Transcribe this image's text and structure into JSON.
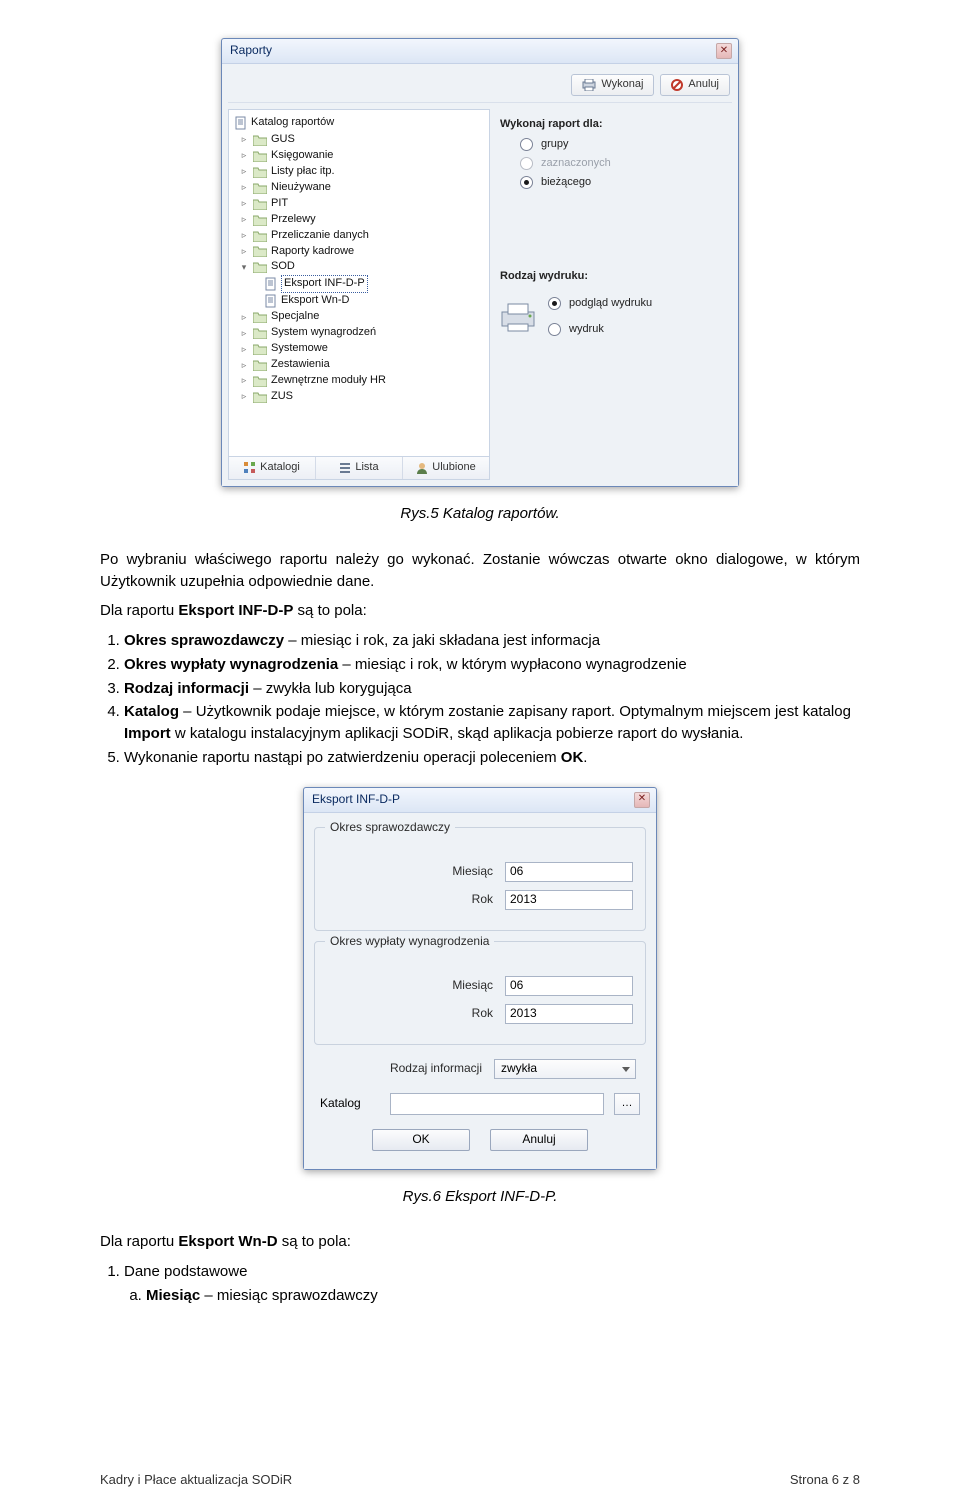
{
  "raporty_win": {
    "title": "Raporty",
    "buttons": {
      "wykonaj": "Wykonaj",
      "anuluj": "Anuluj"
    },
    "tree": {
      "root": "Katalog raportów",
      "items": [
        "GUS",
        "Księgowanie",
        "Listy płac itp.",
        "Nieużywane",
        "PIT",
        "Przelewy",
        "Przeliczanie danych",
        "Raporty kadrowe"
      ],
      "sod": {
        "label": "SOD",
        "children": [
          "Eksport INF-D-P",
          "Eksport Wn-D"
        ]
      },
      "items2": [
        "Specjalne",
        "System wynagrodzeń",
        "Systemowe",
        "Zestawienia",
        "Zewnętrzne moduły HR",
        "ZUS"
      ]
    },
    "tabs": {
      "katalogi": "Katalogi",
      "lista": "Lista",
      "ulubione": "Ulubione"
    },
    "right": {
      "h1": "Wykonaj raport dla:",
      "r1": "grupy",
      "r2": "zaznaczonych",
      "r3": "bieżącego",
      "h2": "Rodzaj wydruku:",
      "p1": "podgląd wydruku",
      "p2": "wydruk"
    }
  },
  "caption1": "Rys.5 Katalog raportów.",
  "para1": "Po wybraniu właściwego raportu należy go wykonać. Zostanie wówczas otwarte okno dialogowe, w którym Użytkownik uzupełnia odpowiednie dane.",
  "para2a": "Dla raportu ",
  "para2b": "Eksport INF-D-P",
  "para2c": " są to pola:",
  "list1": [
    {
      "b": "Okres sprawozdawczy",
      "t": " – miesiąc i rok, za jaki składana jest informacja"
    },
    {
      "b": "Okres wypłaty wynagrodzenia",
      "t": " – miesiąc i rok, w którym wypłacono wynagrodzenie"
    },
    {
      "b": "Rodzaj informacji",
      "t": " – zwykła lub korygująca"
    },
    {
      "b": "Katalog",
      "t": " – Użytkownik podaje miejsce, w którym zostanie zapisany raport. Optymalnym miejscem jest katalog Import w katalogu instalacyjnym aplikacji SODiR, skąd aplikacja pobierze raport do wysłania."
    },
    {
      "b": "",
      "t": "Wykonanie raportu nastąpi po zatwierdzeniu operacji poleceniem OK."
    }
  ],
  "eksport_win": {
    "title": "Eksport INF-D-P",
    "group1": {
      "title": "Okres sprawozdawczy",
      "miesiac_lab": "Miesiąc",
      "miesiac": "06",
      "rok_lab": "Rok",
      "rok": "2013"
    },
    "group2": {
      "title": "Okres wypłaty wynagrodzenia",
      "miesiac_lab": "Miesiąc",
      "miesiac": "06",
      "rok_lab": "Rok",
      "rok": "2013"
    },
    "rodzaj_lab": "Rodzaj informacji",
    "rodzaj_val": "zwykła",
    "katalog_lab": "Katalog",
    "ok": "OK",
    "anuluj": "Anuluj"
  },
  "caption2": "Rys.6 Eksport INF-D-P.",
  "para3a": "Dla raportu ",
  "para3b": "Eksport Wn-D",
  "para3c": " są to pola:",
  "list2": {
    "n1": "Dane podstawe",
    "n1_full": "Dane podstawowe",
    "a_b": "Miesiąc",
    "a_t": " – miesiąc sprawozdawczy"
  },
  "footer": {
    "left": "Kadry i Płace aktualizacja SODiR",
    "right": "Strona 6 z 8"
  }
}
